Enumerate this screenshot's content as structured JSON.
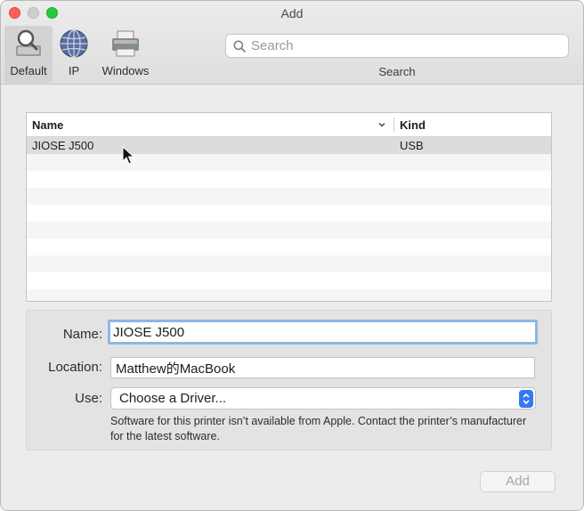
{
  "window": {
    "title": "Add"
  },
  "toolbar": {
    "buttons": [
      {
        "label": "Default",
        "icon": "default-printer-icon",
        "active": true
      },
      {
        "label": "IP",
        "icon": "globe-icon",
        "active": false
      },
      {
        "label": "Windows",
        "icon": "windows-printer-icon",
        "active": false
      }
    ],
    "search": {
      "placeholder": "Search",
      "caption": "Search"
    }
  },
  "list": {
    "columns": {
      "name": "Name",
      "kind": "Kind"
    },
    "rows": [
      {
        "name": "JIOSE J500",
        "kind": "USB",
        "selected": true
      }
    ]
  },
  "details": {
    "name_label": "Name:",
    "name_value": "JIOSE J500",
    "location_label": "Location:",
    "location_value": "Matthew的MacBook",
    "use_label": "Use:",
    "use_value": "Choose a Driver...",
    "hint": "Software for this printer isn’t available from Apple. Contact the printer’s manufacturer for the latest software."
  },
  "footer": {
    "add_label": "Add"
  },
  "colors": {
    "accent": "#3478f6",
    "focus_ring": "#8fb5e8"
  }
}
